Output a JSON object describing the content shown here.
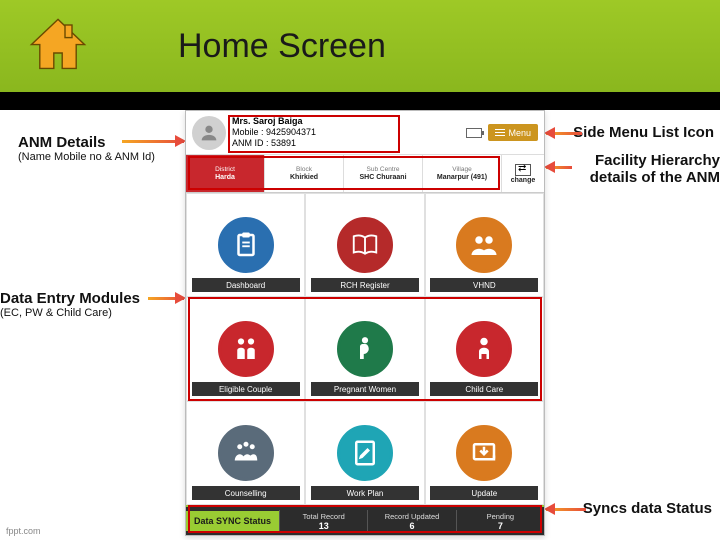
{
  "slide": {
    "title": "Home Screen",
    "footer": "fppt.com"
  },
  "callouts": {
    "anm_details": "ANM Details",
    "anm_details_sub": "(Name Mobile no & ANM Id)",
    "side_menu": "Side Menu List Icon",
    "hierarchy": "Facility Hierarchy details of the ANM",
    "data_entry": "Data Entry Modules",
    "data_entry_sub": "(EC, PW & Child Care)",
    "sync": "Syncs data Status"
  },
  "app": {
    "user": {
      "name": "Mrs. Saroj Baiga",
      "mobile": "Mobile : 9425904371",
      "anm_id": "ANM ID : 53891"
    },
    "menu_label": "Menu",
    "hierarchy": [
      {
        "label": "District",
        "value": "Harda"
      },
      {
        "label": "Block",
        "value": "Khirkied"
      },
      {
        "label": "Sub Centre",
        "value": "SHC Churaani"
      },
      {
        "label": "Village",
        "value": "Manarpur (491)"
      }
    ],
    "change_label": "change",
    "tiles": [
      {
        "label": "Dashboard",
        "color": "#2a6fb0",
        "icon": "clipboard"
      },
      {
        "label": "RCH Register",
        "color": "#b52a2a",
        "icon": "book"
      },
      {
        "label": "VHND",
        "color": "#d97a1f",
        "icon": "group"
      },
      {
        "label": "Eligible Couple",
        "color": "#c8272d",
        "icon": "couple"
      },
      {
        "label": "Pregnant Women",
        "color": "#1f7a4a",
        "icon": "pregnant"
      },
      {
        "label": "Child Care",
        "color": "#c8272d",
        "icon": "child"
      },
      {
        "label": "Counselling",
        "color": "#5a6b7a",
        "icon": "counsel"
      },
      {
        "label": "Work Plan",
        "color": "#1fa5b5",
        "icon": "workplan"
      },
      {
        "label": "Update",
        "color": "#d97a1f",
        "icon": "update"
      }
    ],
    "sync": {
      "title": "Data SYNC Status",
      "cells": [
        {
          "label": "Total Record",
          "value": "13"
        },
        {
          "label": "Record Updated",
          "value": "6"
        },
        {
          "label": "Pending",
          "value": "7"
        }
      ]
    }
  }
}
